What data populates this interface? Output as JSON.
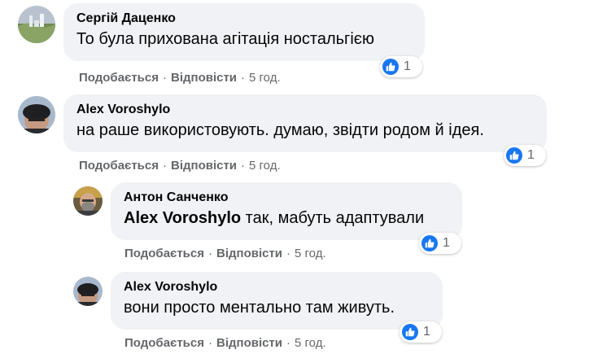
{
  "comments": [
    {
      "author": "Сергій Даценко",
      "text": "То була прихована агітація ностальгією",
      "reaction_count": "1",
      "like_label": "Подобається",
      "reply_label": "Відповісти",
      "time": "5 год."
    },
    {
      "author": "Alex Voroshylo",
      "text": "на раше використовують. думаю, звідти родом й ідея.",
      "reaction_count": "1",
      "like_label": "Подобається",
      "reply_label": "Відповісти",
      "time": "5 год."
    },
    {
      "author": "Антон Санченко",
      "mention": "Alex Voroshylo",
      "text": " так, мабуть адаптували",
      "reaction_count": "1",
      "like_label": "Подобається",
      "reply_label": "Відповісти",
      "time": "5 год."
    },
    {
      "author": "Alex Voroshylo",
      "text": "вони просто ментально там живуть.",
      "reaction_count": "1",
      "like_label": "Подобається",
      "reply_label": "Відповісти",
      "time": "5 год."
    }
  ],
  "separator": "·",
  "colors": {
    "bubble": "#f0f2f5",
    "like_blue": "#1877f2",
    "secondary_text": "#65676b"
  },
  "icons": {
    "reaction": "thumbs-up-icon"
  }
}
